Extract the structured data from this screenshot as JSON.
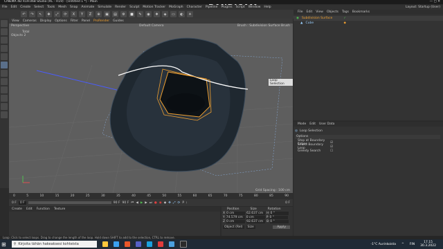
{
  "window": {
    "title": "CINEMA 4D R19.068 Studio (RC - R19) - [Untitled 1 *] - Main"
  },
  "watermark": "www.BANDICAM.com",
  "menubar": [
    "File",
    "Edit",
    "Create",
    "Select",
    "Tools",
    "Mesh",
    "Snap",
    "Animate",
    "Simulate",
    "Render",
    "Sculpt",
    "Motion Tracker",
    "MoGraph",
    "Character",
    "Pipeline",
    "Plugins",
    "Script",
    "Window",
    "Help"
  ],
  "layout": {
    "label": "Layout:",
    "value": "Startup (User)"
  },
  "toolbar": {
    "axis_x": "X",
    "axis_y": "Y",
    "axis_z": "Z"
  },
  "viewport": {
    "menu": [
      "View",
      "Cameras",
      "Display",
      "Options",
      "Filter",
      "Panel",
      "ProRender"
    ],
    "active_menu": "ProRender",
    "extra": "Guides",
    "label": "Perspective",
    "camera": "Default Camera",
    "mode": "Brush : Subdivision Surface Brush",
    "stats_title": "Total",
    "stats_objects_label": "Objects",
    "stats_objects_value": "2",
    "tooltip": "Loop Selection",
    "grid_spacing": "Grid Spacing : 100 cm"
  },
  "object_manager": {
    "menu": [
      "File",
      "Edit",
      "View",
      "Objects",
      "Tags",
      "Bookmarks"
    ],
    "items": [
      {
        "name": "Subdivision Surface",
        "color": "#f0a030"
      },
      {
        "name": "Cube",
        "color": "#9ad0ff"
      }
    ]
  },
  "attributes": {
    "menu": [
      "Mode",
      "Edit",
      "User Data"
    ],
    "title": "Loop Selection",
    "tab": "Options",
    "options": [
      {
        "label": "Stop at Boundary Edges",
        "checked": true
      },
      {
        "label": "Select Boundary Loop",
        "checked": true
      },
      {
        "label": "Greedy Search",
        "checked": false
      }
    ]
  },
  "timeline": {
    "ticks": [
      "0",
      "5",
      "10",
      "15",
      "20",
      "25",
      "30",
      "35",
      "40",
      "45",
      "50",
      "55",
      "60",
      "65",
      "70",
      "75",
      "80",
      "85",
      "90"
    ],
    "frame_start": "0 F",
    "frame_current": "0 F",
    "frame_end": "90 F",
    "frame_end2": "90 F",
    "frame_display": "0 F"
  },
  "material_manager": {
    "menu": [
      "Create",
      "Edit",
      "Function",
      "Texture"
    ]
  },
  "coordinates": {
    "headers": [
      "Position",
      "Size",
      "Rotation"
    ],
    "rows": [
      {
        "axis": "X",
        "pos": "0 cm",
        "size": "62.637 cm",
        "rot_axis": "H",
        "rot": "0 °"
      },
      {
        "axis": "Y",
        "pos": "74.579 cm",
        "size": "0 cm",
        "rot_axis": "P",
        "rot": "0 °"
      },
      {
        "axis": "Z",
        "pos": "0 cm",
        "size": "92.637 cm",
        "rot_axis": "B",
        "rot": "0 °"
      }
    ],
    "mode1": "Object (Rel)",
    "mode2": "Size",
    "apply": "Apply"
  },
  "status_bar": "Loop: Click to select loops. Drag to change the length of the loop. Hold down SHIFT to add to the selection, CTRL to remove.",
  "taskbar": {
    "search_placeholder": "Kirjoita tähän hakeaksesi kohteista",
    "weather": "-1°C  Aurinkoista",
    "lang": "FIN",
    "time": "17.15",
    "date": "30.3.2022"
  },
  "colors": {
    "accent": "#f0a030",
    "viewport_bg": "#5e5e5e",
    "selection": "#ffffff"
  }
}
